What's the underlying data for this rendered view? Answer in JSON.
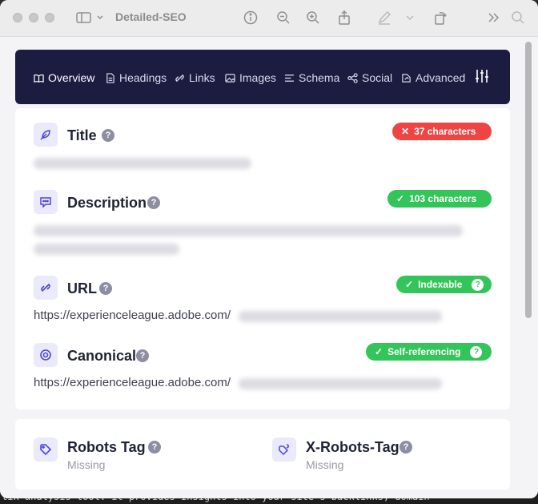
{
  "window": {
    "title": "Detailed-SEO"
  },
  "nav": {
    "tabs": [
      {
        "label": "Overview",
        "icon": "book-open-icon",
        "active": true
      },
      {
        "label": "Headings",
        "icon": "document-icon",
        "active": false
      },
      {
        "label": "Links",
        "icon": "link-icon",
        "active": false
      },
      {
        "label": "Images",
        "icon": "image-icon",
        "active": false
      },
      {
        "label": "Schema",
        "icon": "align-left-icon",
        "active": false
      },
      {
        "label": "Social",
        "icon": "share-icon",
        "active": false
      },
      {
        "label": "Advanced",
        "icon": "advanced-icon",
        "active": false
      }
    ],
    "settings_icon": "sliders-icon"
  },
  "sections": {
    "title": {
      "heading": "Title",
      "help": "?",
      "badge": "37 characters",
      "badge_status": "error",
      "badge_mark": "✕"
    },
    "description": {
      "heading": "Description",
      "help": "?",
      "badge": "103 characters",
      "badge_status": "ok",
      "badge_mark": "✓"
    },
    "url": {
      "heading": "URL",
      "help": "?",
      "badge": "Indexable",
      "badge_status": "ok",
      "badge_mark": "✓",
      "badge_help": "?",
      "value": "https://experienceleague.adobe.com/"
    },
    "canonical": {
      "heading": "Canonical",
      "help": "?",
      "badge": "Self-referencing",
      "badge_status": "ok",
      "badge_mark": "✓",
      "badge_help": "?",
      "value": "https://experienceleague.adobe.com/"
    }
  },
  "robots": {
    "robots_tag": {
      "heading": "Robots Tag",
      "help": "?",
      "status": "Missing"
    },
    "x_robots_tag": {
      "heading": "X-Robots-Tag",
      "help": "?",
      "status": "Missing"
    }
  },
  "background_text": "lik analysis tool: it provides insights into your site's backlinks, domain",
  "colors": {
    "nav_bg": "#1c1b40",
    "accent": "#4f45d6",
    "error": "#ef4444",
    "success": "#34c55a"
  }
}
